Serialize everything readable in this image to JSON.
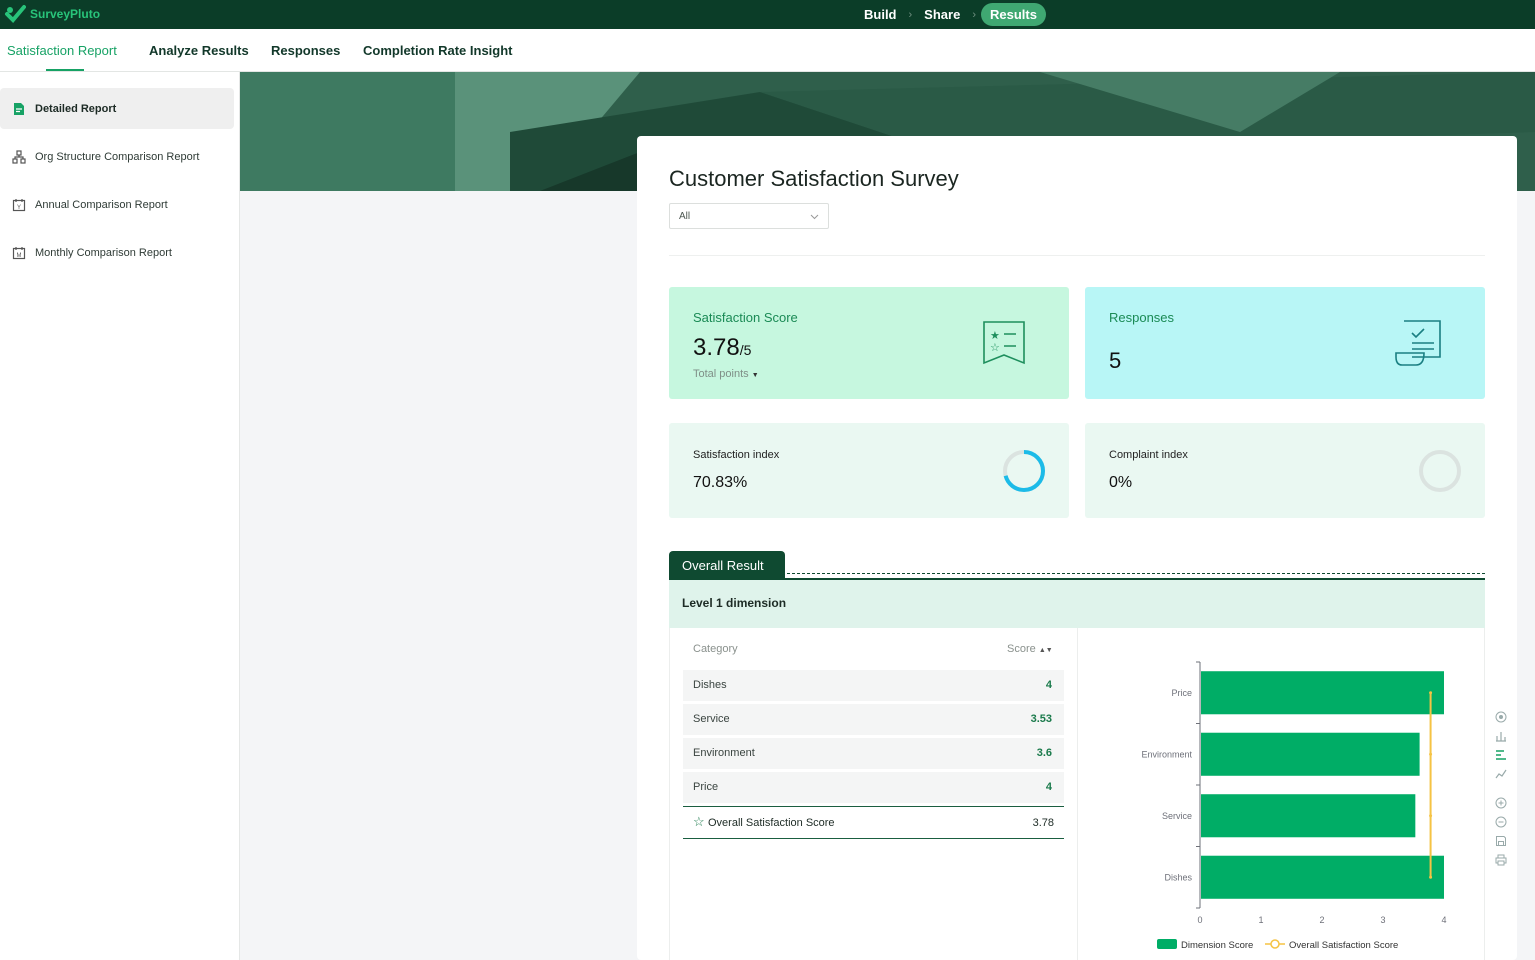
{
  "app": {
    "name": "SurveyPluto"
  },
  "steps": [
    {
      "label": "Build"
    },
    {
      "label": "Share"
    },
    {
      "label": "Results"
    }
  ],
  "tabs": [
    {
      "label": "Satisfaction Report",
      "active": true
    },
    {
      "label": "Analyze Results"
    },
    {
      "label": "Responses"
    },
    {
      "label": "Completion Rate Insight"
    }
  ],
  "sidebar": {
    "items": [
      {
        "label": "Detailed Report",
        "icon": "report-icon",
        "active": true
      },
      {
        "label": "Org Structure Comparison Report",
        "icon": "org-chart-icon"
      },
      {
        "label": "Annual Comparison Report",
        "icon": "calendar-year-icon"
      },
      {
        "label": "Monthly Comparison Report",
        "icon": "calendar-month-icon"
      }
    ]
  },
  "survey": {
    "title": "Customer Satisfaction Survey",
    "filter": "All"
  },
  "stats": {
    "satisfaction": {
      "label": "Satisfaction Score",
      "value": "3.78",
      "suffix": "/5",
      "sub": "Total points"
    },
    "responses": {
      "label": "Responses",
      "value": "5"
    },
    "satisfaction_index": {
      "label": "Satisfaction index",
      "value": "70.83%",
      "fraction": 0.7083
    },
    "complaint_index": {
      "label": "Complaint index",
      "value": "0%",
      "fraction": 0
    }
  },
  "overall": {
    "tab": "Overall Result",
    "level": "Level 1 dimension",
    "columns": {
      "category": "Category",
      "score": "Score"
    },
    "rows": [
      {
        "category": "Dishes",
        "score": "4"
      },
      {
        "category": "Service",
        "score": "3.53"
      },
      {
        "category": "Environment",
        "score": "3.6"
      },
      {
        "category": "Price",
        "score": "4"
      }
    ],
    "total": {
      "label": "Overall Satisfaction Score",
      "score": "3.78"
    }
  },
  "colors": {
    "bar": "#00ad66",
    "line": "#f5c344",
    "accent": "#17a265",
    "dark": "#0b3d28"
  },
  "chart_data": {
    "type": "bar",
    "orientation": "horizontal",
    "categories": [
      "Dishes",
      "Service",
      "Environment",
      "Price"
    ],
    "series": [
      {
        "name": "Dimension Score",
        "values": [
          4,
          3.53,
          3.6,
          4
        ]
      },
      {
        "name": "Overall Satisfaction Score",
        "values": [
          3.78,
          3.78,
          3.78,
          3.78
        ]
      }
    ],
    "xlim": [
      0,
      4
    ],
    "xticks": [
      "0",
      "1",
      "2",
      "3",
      "4"
    ],
    "legend": "bottom"
  }
}
